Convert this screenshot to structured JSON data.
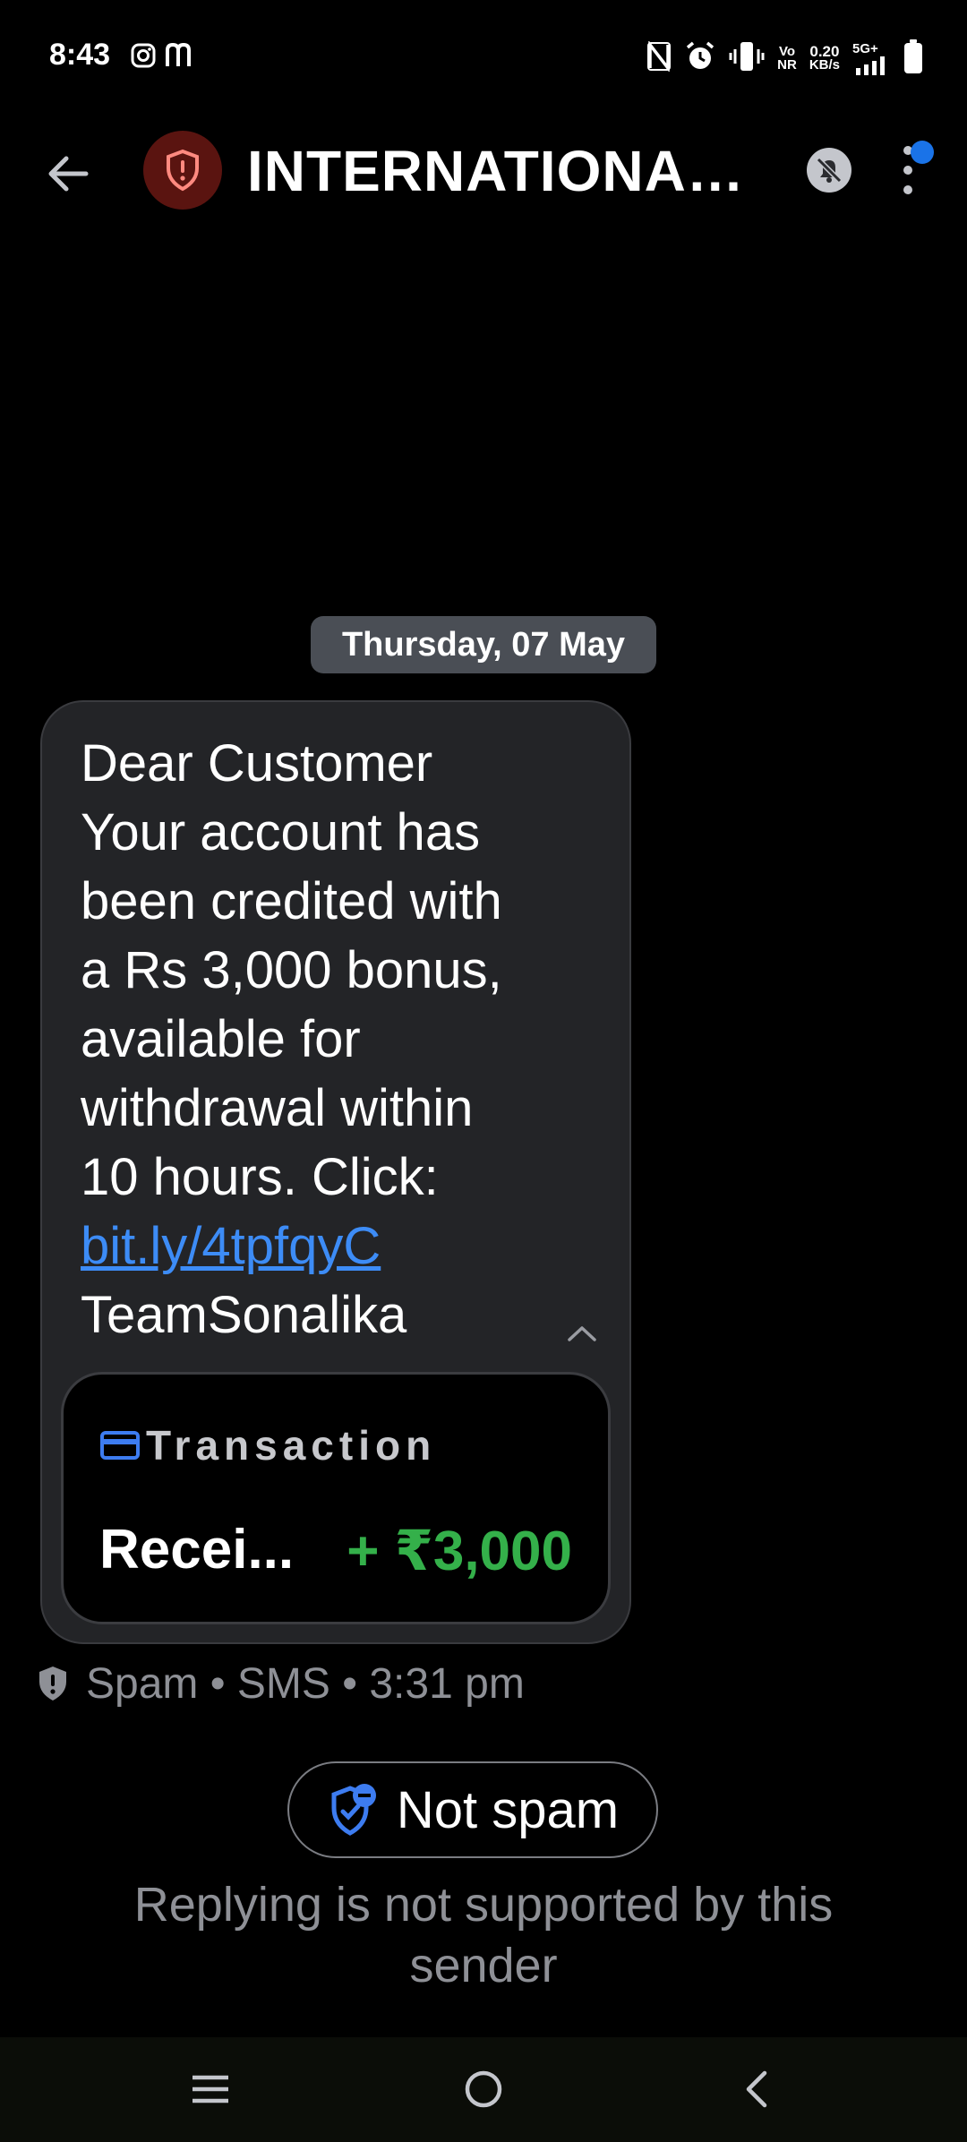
{
  "status_bar": {
    "time": "8:43",
    "app_icons": [
      "instagram-icon",
      "m-app-icon"
    ],
    "right_icons": [
      "nfc-icon",
      "alarm-icon",
      "vibrate-icon"
    ],
    "vo_top": "Vo",
    "vo_bottom": "NR",
    "speed_value": "0.20",
    "speed_unit": "KB/s",
    "network": "5G+"
  },
  "app_bar": {
    "contact_name": "INTERNATIONAL...",
    "avatar_icon": "spam-shield-icon"
  },
  "conversation": {
    "date_chip": "Thursday, 07 May",
    "message": {
      "text_lines": [
        "Dear Customer",
        "Your account has",
        "been credited with",
        "a Rs 3,000 bonus,",
        "available for",
        "withdrawal within",
        "10 hours. Click:"
      ],
      "link": "bit.ly/4tpfqyC",
      "signature": "TeamSonalika"
    },
    "transaction": {
      "label": "Transaction",
      "name": "Recei...",
      "amount": "+ ₹3,000",
      "amount_color": "#34b04a"
    },
    "meta": "Spam • SMS • 3:31 pm"
  },
  "actions": {
    "not_spam_label": "Not spam",
    "reply_note": "Replying is not supported by this sender"
  },
  "colors": {
    "accent": "#1a73e8",
    "link": "#3d8cf6",
    "spam_avatar": "#5a1410"
  }
}
